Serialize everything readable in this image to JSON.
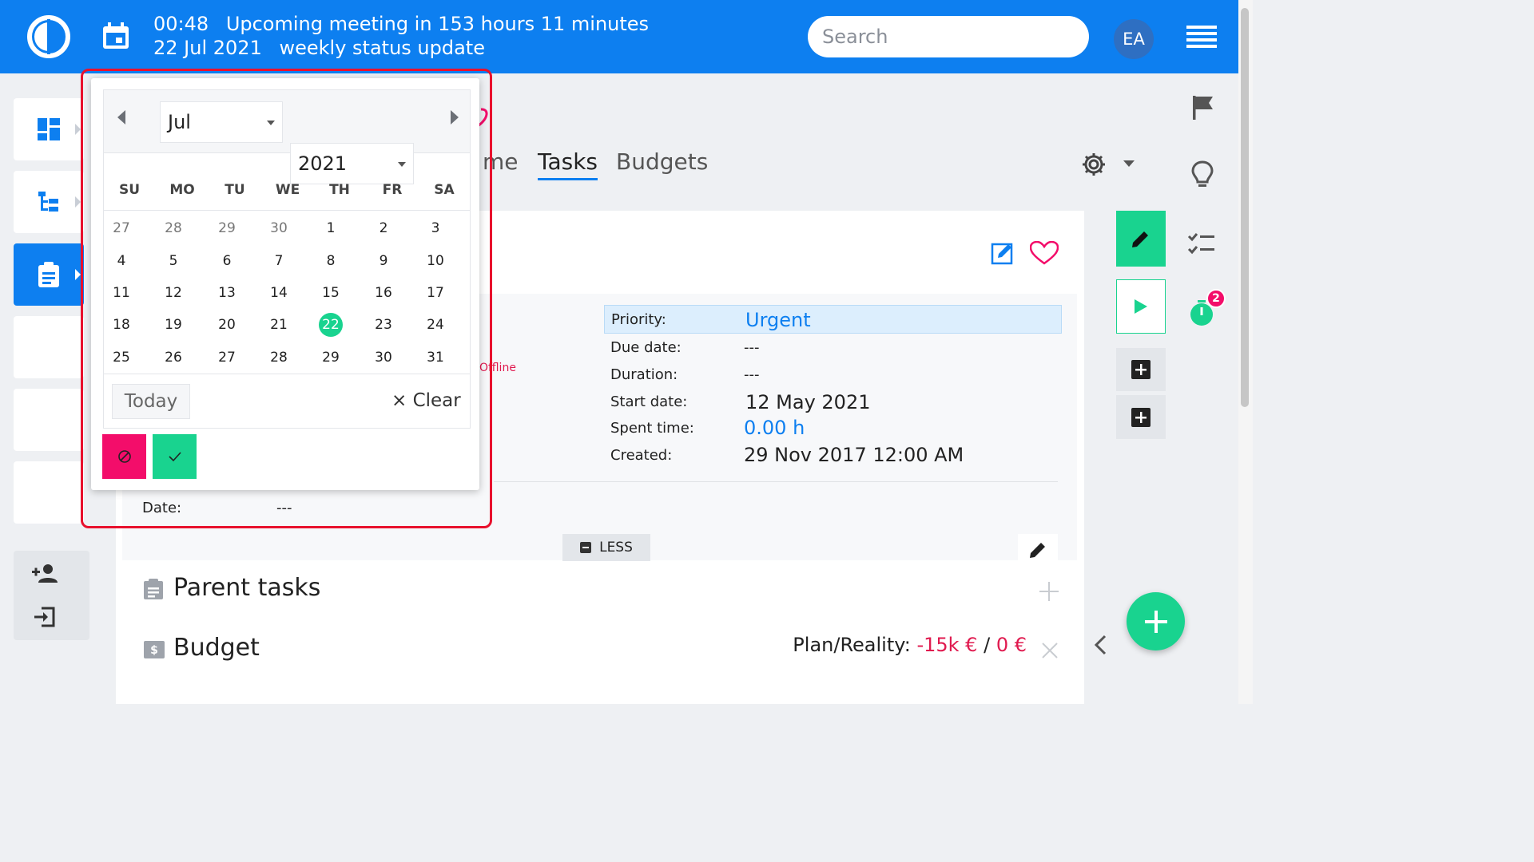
{
  "header": {
    "time": "00:48",
    "meeting_text": "Upcoming meeting in 153 hours 11 minutes",
    "date": "22 Jul 2021",
    "meeting_title": "weekly status update",
    "search_placeholder": "Search",
    "user_initials": "EA",
    "colors": {
      "header_bg": "#0d7ff0",
      "accent_green": "#19d38f",
      "danger_pink": "#f30d6a"
    }
  },
  "tabs": [
    {
      "label": "me"
    },
    {
      "label": "Tasks"
    },
    {
      "label": "Budgets"
    }
  ],
  "task_details": {
    "offline_text": "Offline",
    "priority_label": "Priority:",
    "priority_value": "Urgent",
    "due_date_label": "Due date:",
    "due_date_value": "---",
    "duration_label": "Duration:",
    "duration_value": "---",
    "start_date_label": "Start date:",
    "start_date_value": "12 May 2021",
    "spent_time_label": "Spent time:",
    "spent_time_value": "0.00 h",
    "created_label": "Created:",
    "created_value": "29 Nov 2017 12:00 AM",
    "date_label": "Date:",
    "date_value": "---",
    "less_label": "LESS"
  },
  "sections": {
    "parent_tasks": "Parent tasks",
    "budget": "Budget",
    "plan_reality_label": "Plan/Reality:",
    "plan_value": "-15k €",
    "separator": "/",
    "reality_value": "0 €"
  },
  "right_rail": {
    "timer_badge": "2"
  },
  "datepicker": {
    "month": "Jul",
    "year": "2021",
    "weekdays": [
      "SU",
      "MO",
      "TU",
      "WE",
      "TH",
      "FR",
      "SA"
    ],
    "weeks": [
      [
        "27",
        "28",
        "29",
        "30",
        "1",
        "2",
        "3"
      ],
      [
        "4",
        "5",
        "6",
        "7",
        "8",
        "9",
        "10"
      ],
      [
        "11",
        "12",
        "13",
        "14",
        "15",
        "16",
        "17"
      ],
      [
        "18",
        "19",
        "20",
        "21",
        "22",
        "23",
        "24"
      ],
      [
        "25",
        "26",
        "27",
        "28",
        "29",
        "30",
        "31"
      ]
    ],
    "selected_day": "22",
    "today_label": "Today",
    "clear_label": "× Clear"
  }
}
